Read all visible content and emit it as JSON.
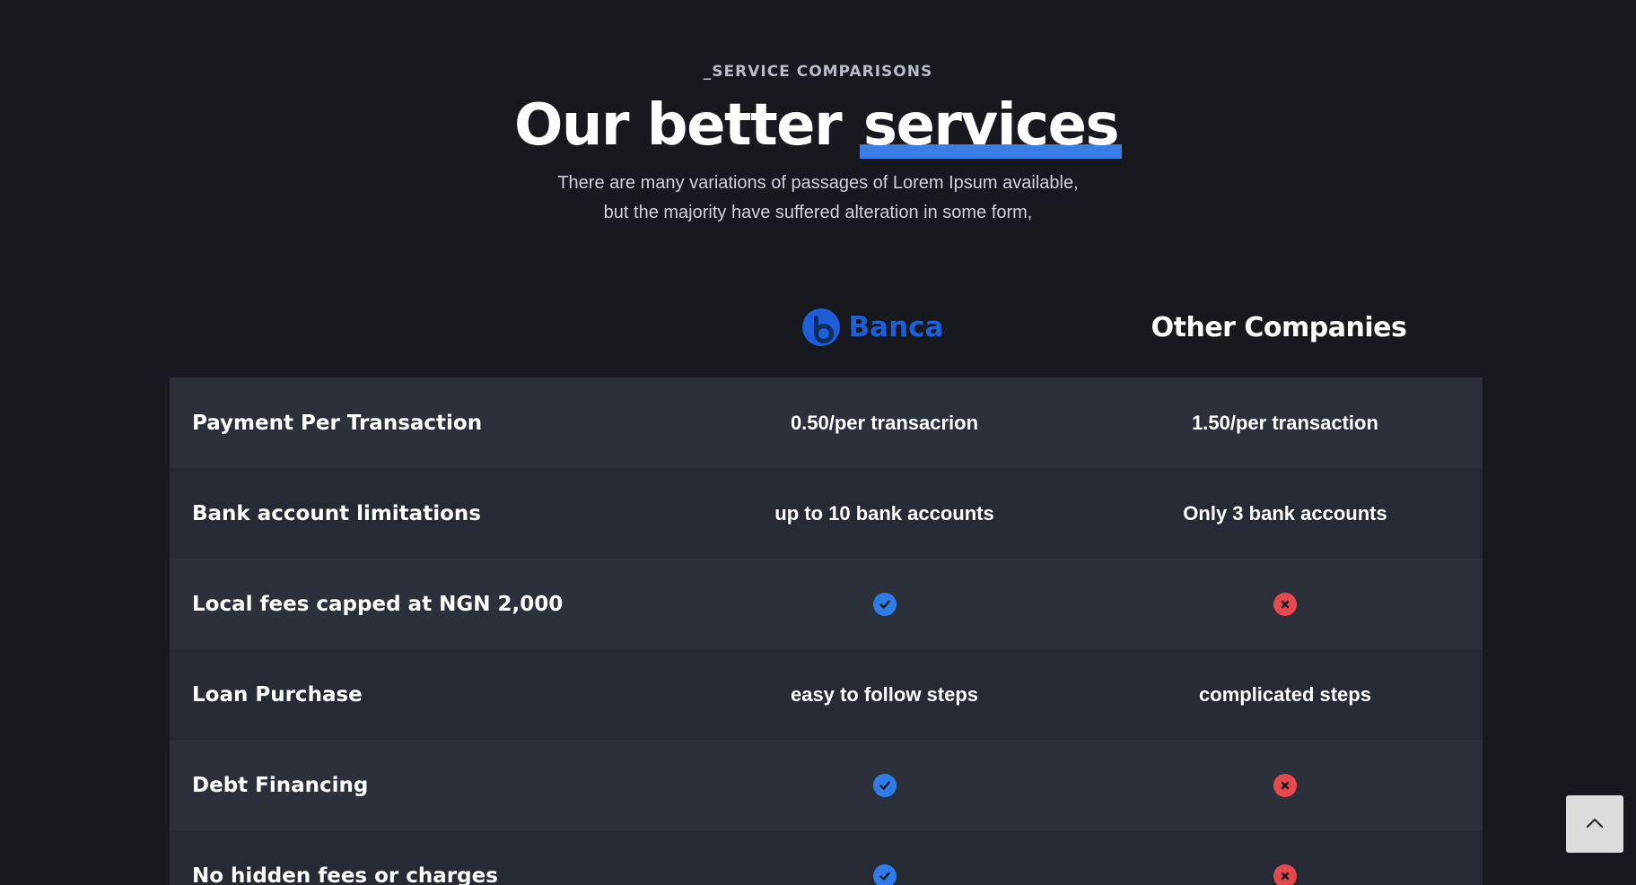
{
  "section": {
    "eyebrow": "_SERVICE COMPARISONS",
    "title_main": "Our better ",
    "title_highlight": "services",
    "description_line1": "There are many variations of passages of Lorem Ipsum available,",
    "description_line2": "but the majority have suffered alteration in some form,"
  },
  "columns": {
    "brand_name": "Banca",
    "other": "Other Companies"
  },
  "rows": [
    {
      "label": "Payment Per Transaction",
      "banca": "0.50/per transacrion",
      "other": "1.50/per transaction"
    },
    {
      "label": "Bank account limitations",
      "banca": "up to 10 bank accounts",
      "other": "Only 3 bank accounts"
    },
    {
      "label": "Local fees capped at NGN 2,000",
      "banca_icon": "check-icon",
      "other_icon": "cross-icon"
    },
    {
      "label": "Loan Purchase",
      "banca": "easy to follow steps",
      "other": "complicated steps"
    },
    {
      "label": "Debt Financing",
      "banca_icon": "check-icon",
      "other_icon": "cross-icon"
    },
    {
      "label": "No hidden fees or charges",
      "banca_icon": "check-icon",
      "other_icon": "cross-icon"
    }
  ],
  "colors": {
    "accent": "#2f7be8",
    "negative": "#e5484d",
    "brand": "#1e5ed6"
  },
  "scroll_top_icon": "chevron-up-icon"
}
